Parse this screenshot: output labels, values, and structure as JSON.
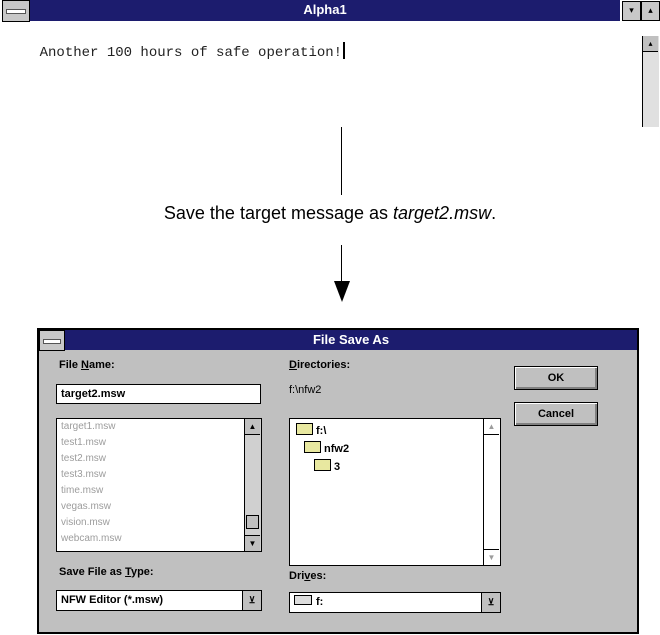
{
  "editor": {
    "title": "Alpha1",
    "text": "Another 100 hours of safe operation!",
    "minimize_glyph": "▾",
    "maximize_glyph": "▴",
    "scroll_up_glyph": "▴"
  },
  "caption": {
    "prefix": "Save the target message as ",
    "filename": "target2.msw",
    "suffix": "."
  },
  "dialog": {
    "title": "File Save As",
    "file_name_label_pre": "File ",
    "file_name_label_ul": "N",
    "file_name_label_post": "ame:",
    "file_name_value": "target2.msw",
    "files": [
      "target1.msw",
      "test1.msw",
      "test2.msw",
      "test3.msw",
      "time.msw",
      "vegas.msw",
      "vision.msw",
      "webcam.msw"
    ],
    "save_type_label_pre": "Save File as ",
    "save_type_label_ul": "T",
    "save_type_label_post": "ype:",
    "save_type_value": "NFW Editor (*.msw)",
    "directories_label_ul": "D",
    "directories_label_post": "irectories:",
    "current_dir": "f:\\nfw2",
    "dirs": [
      "f:\\",
      "nfw2",
      "3"
    ],
    "drives_label_pre": "Dri",
    "drives_label_ul": "v",
    "drives_label_post": "es:",
    "drive_value": "f:",
    "ok_label": "OK",
    "cancel_label": "Cancel"
  }
}
